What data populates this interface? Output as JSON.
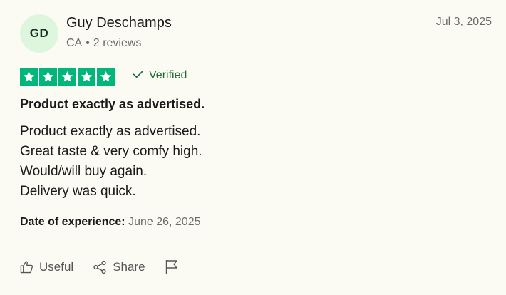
{
  "reviewer": {
    "initials": "GD",
    "name": "Guy Deschamps",
    "country": "CA",
    "separator": "•",
    "reviews": "2 reviews"
  },
  "review": {
    "date": "Jul 3, 2025",
    "rating": 5,
    "rating_max": 5,
    "verified_label": "Verified",
    "title": "Product exactly as advertised.",
    "body_lines": [
      "Product exactly as advertised.",
      "Great taste & very comfy high.",
      "Would/will buy again.",
      "Delivery was quick."
    ],
    "experience_label": "Date of experience:",
    "experience_date": "June 26, 2025"
  },
  "actions": {
    "useful_label": "Useful",
    "share_label": "Share"
  },
  "colors": {
    "star_green": "#00b67a",
    "avatar_bg": "#dcf7dd",
    "verified_text": "#1f6b34"
  },
  "icons": {
    "verified": "check-icon",
    "useful": "thumbs-up-icon",
    "share": "share-icon",
    "report": "flag-icon"
  }
}
